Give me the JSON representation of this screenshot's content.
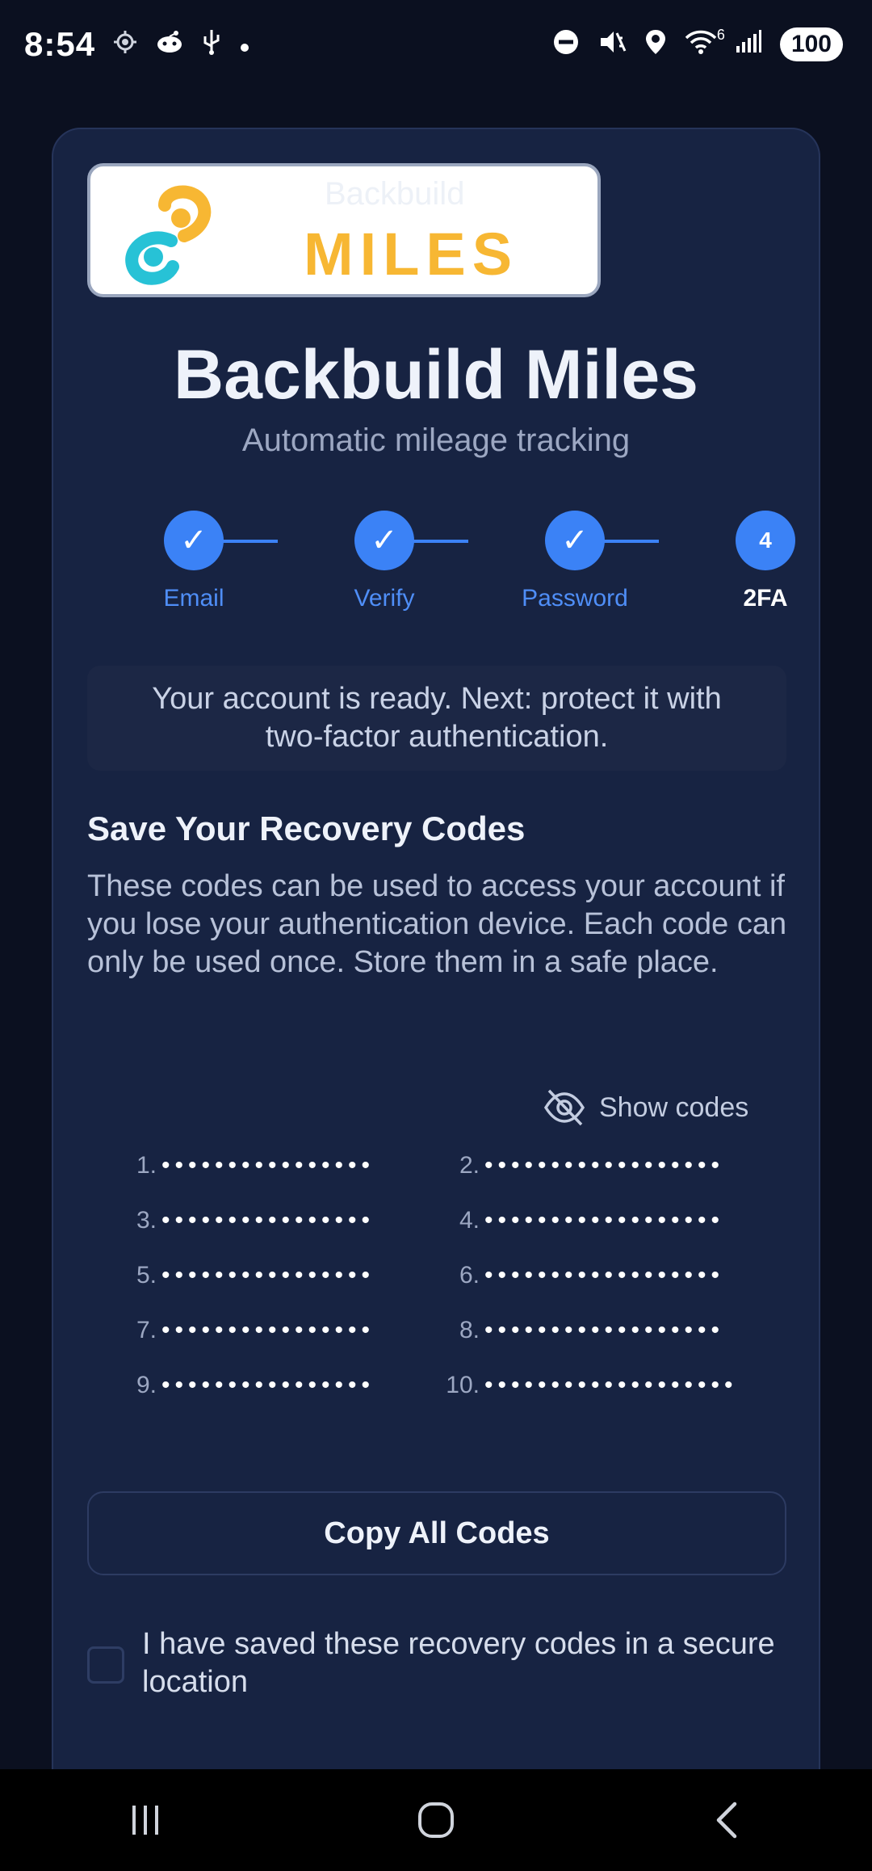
{
  "status_bar": {
    "time": "8:54",
    "signal_sup": "6",
    "battery": "100",
    "left_icons": [
      "location-target-icon",
      "reddit-icon",
      "usb-icon",
      "dot-icon"
    ],
    "right_icons": [
      "do-not-disturb-icon",
      "mute-vibrate-icon",
      "location-pin-icon",
      "wifi-icon",
      "cell-signal-icon",
      "battery-icon"
    ]
  },
  "logo": {
    "ghost_text": "Backbuild",
    "wordmark": "MILES",
    "colors": {
      "orange": "#f7b733",
      "cyan": "#27c2d6"
    }
  },
  "header": {
    "title": "Backbuild Miles",
    "subtitle": "Automatic mileage tracking"
  },
  "stepper": {
    "steps": [
      {
        "label": "Email",
        "state": "complete",
        "mark": "✓"
      },
      {
        "label": "Verify",
        "state": "complete",
        "mark": "✓"
      },
      {
        "label": "Password",
        "state": "complete",
        "mark": "✓"
      },
      {
        "label": "2FA",
        "state": "active",
        "mark": "4"
      }
    ],
    "accent_color": "#3b82f6"
  },
  "info_banner": "Your account is ready. Next: protect it with two-factor authentication.",
  "recovery": {
    "title": "Save Your Recovery Codes",
    "description": "These codes can be used to access your account if you lose your authentication device. Each code can only be used once. Store them in a safe place.",
    "show_codes_label": "Show codes",
    "codes": [
      {
        "num": "1.",
        "masked": "••••••••••••••••"
      },
      {
        "num": "2.",
        "masked": "••••••••••••••••••"
      },
      {
        "num": "3.",
        "masked": "••••••••••••••••"
      },
      {
        "num": "4.",
        "masked": "••••••••••••••••••"
      },
      {
        "num": "5.",
        "masked": "••••••••••••••••"
      },
      {
        "num": "6.",
        "masked": "••••••••••••••••••"
      },
      {
        "num": "7.",
        "masked": "••••••••••••••••"
      },
      {
        "num": "8.",
        "masked": "••••••••••••••••••"
      },
      {
        "num": "9.",
        "masked": "••••••••••••••••"
      },
      {
        "num": "10.",
        "masked": "•••••••••••••••••••"
      }
    ],
    "copy_button": "Copy All Codes",
    "confirm_label": "I have saved these recovery codes in a secure location"
  },
  "nav_bar": {
    "buttons": [
      "recents-icon",
      "home-icon",
      "back-icon"
    ]
  }
}
